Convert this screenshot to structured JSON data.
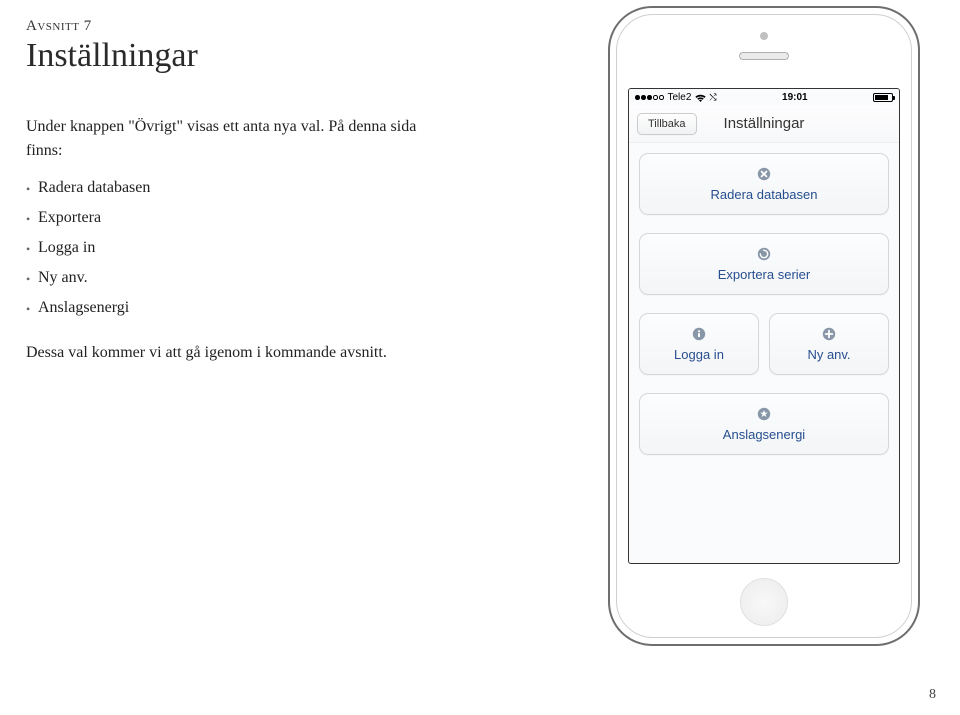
{
  "section": {
    "label": "Avsnitt 7",
    "title": "Inställningar"
  },
  "body": {
    "intro": "Under knappen \"Övrigt\" visas ett anta nya val. På denna sida finns:",
    "bullets": [
      "Radera databasen",
      "Exportera",
      "Logga in",
      "Ny anv.",
      "Anslagsenergi"
    ],
    "outro": "Dessa val kommer vi att gå igenom i kommande avsnitt."
  },
  "phone": {
    "status": {
      "carrier": "Tele2",
      "time": "19:01"
    },
    "nav": {
      "back": "Tillbaka",
      "title": "Inställningar"
    },
    "cards": {
      "delete": "Radera databasen",
      "export": "Exportera serier",
      "login": "Logga in",
      "newuser": "Ny anv.",
      "energy": "Anslagsenergi"
    }
  },
  "pagenum": "8"
}
